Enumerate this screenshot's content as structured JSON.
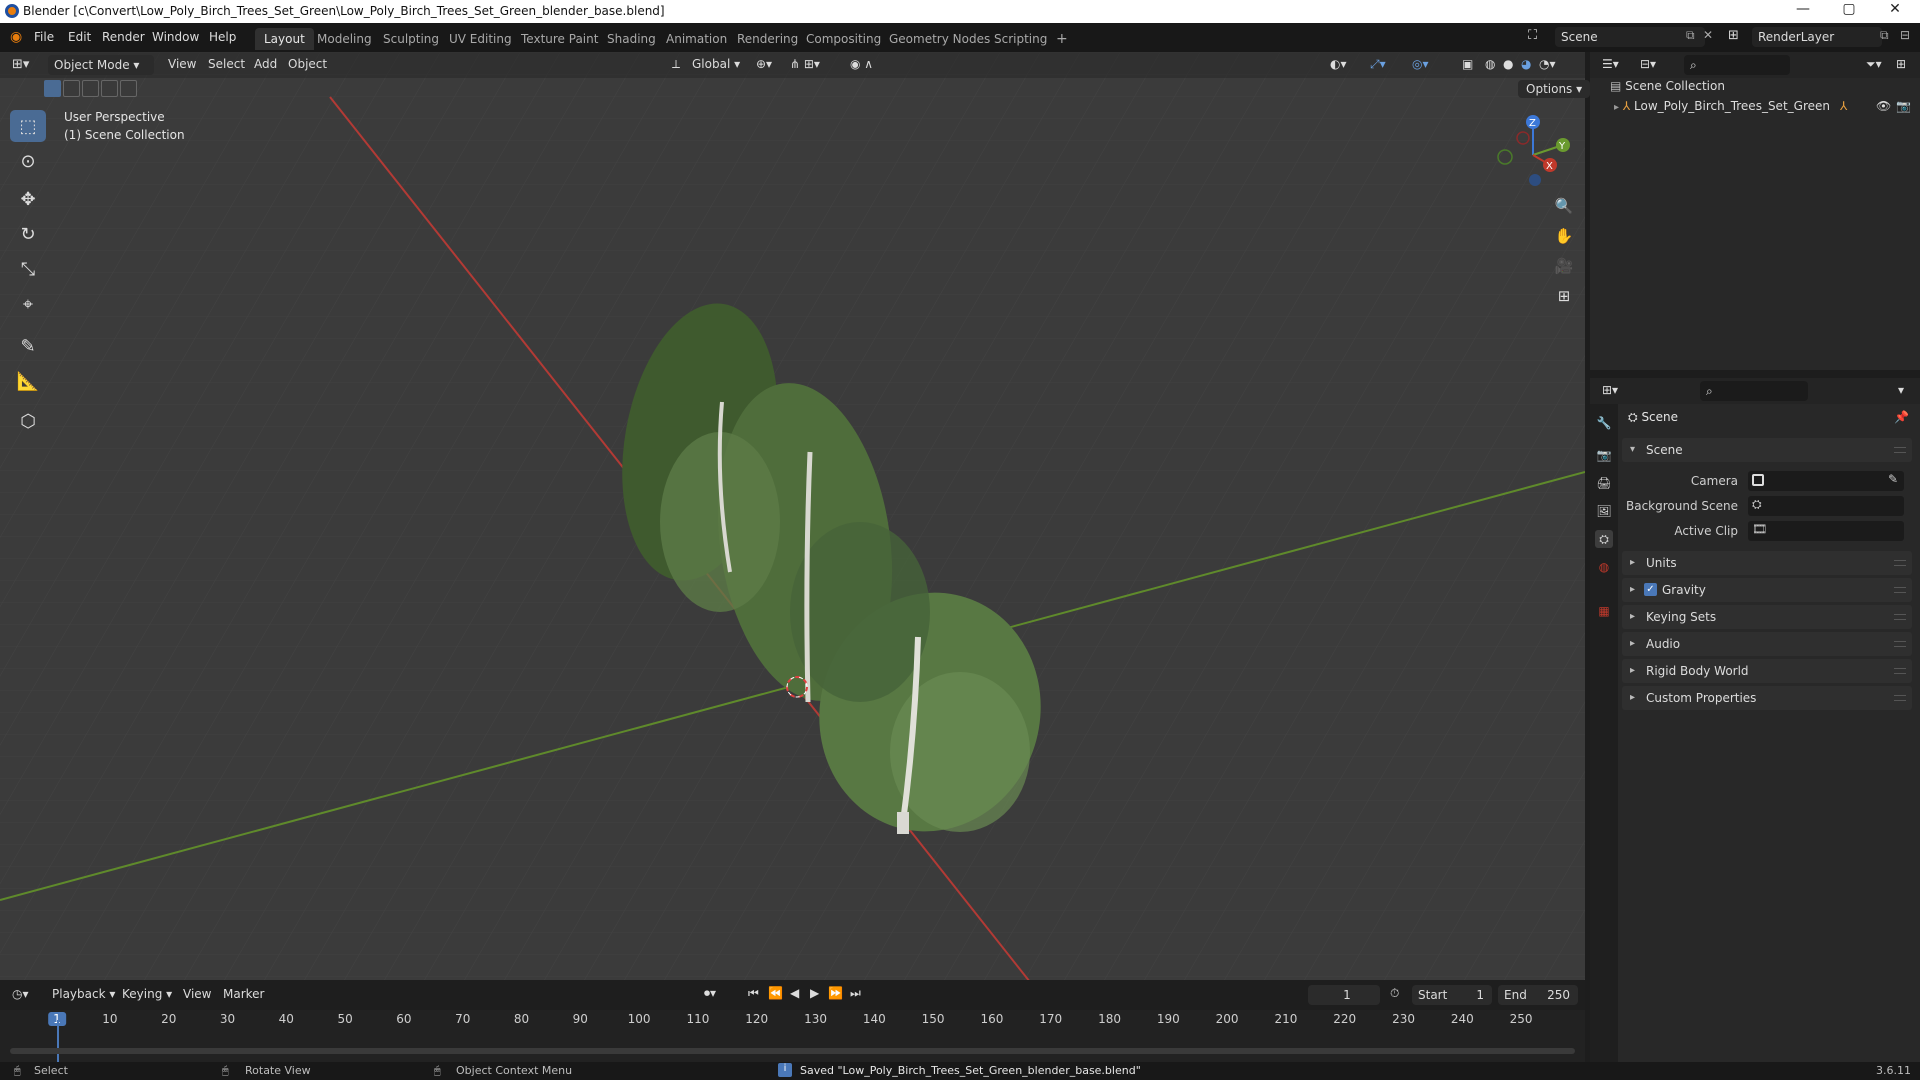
{
  "window": {
    "title": "Blender [c\\Convert\\Low_Poly_Birch_Trees_Set_Green\\Low_Poly_Birch_Trees_Set_Green_blender_base.blend]",
    "minimize": "—",
    "maximize": "▢",
    "close": "✕"
  },
  "menu": [
    "File",
    "Edit",
    "Render",
    "Window",
    "Help"
  ],
  "workspaces": [
    "Layout",
    "Modeling",
    "Sculpting",
    "UV Editing",
    "Texture Paint",
    "Shading",
    "Animation",
    "Rendering",
    "Compositing",
    "Geometry Nodes",
    "Scripting",
    "+"
  ],
  "active_workspace": "Layout",
  "scene_name": "Scene",
  "view_layer": "RenderLayer",
  "viewport_header": {
    "mode": "Object Mode",
    "menus": [
      "View",
      "Select",
      "Add",
      "Object"
    ],
    "transform_orientation": "Global",
    "options": "Options"
  },
  "viewport_overlay": {
    "line1": "User Perspective",
    "line2": "(1) Scene Collection"
  },
  "gizmo": {
    "x": "X",
    "y": "Y",
    "z": "Z"
  },
  "outliner": {
    "root": "Scene Collection",
    "items": [
      {
        "label": "Low_Poly_Birch_Trees_Set_Green"
      }
    ]
  },
  "properties": {
    "context": "Scene",
    "scene_panel": "Scene",
    "fields": [
      {
        "label": "Camera"
      },
      {
        "label": "Background Scene"
      },
      {
        "label": "Active Clip"
      }
    ],
    "sections": [
      "Units",
      "Gravity",
      "Keying Sets",
      "Audio",
      "Rigid Body World",
      "Custom Properties"
    ],
    "gravity_checked": true
  },
  "timeline": {
    "menus": [
      "Playback",
      "Keying",
      "View",
      "Marker"
    ],
    "current_frame": "1",
    "start_label": "Start",
    "start": "1",
    "end_label": "End",
    "end": "250",
    "ticks": [
      "1",
      "10",
      "20",
      "30",
      "40",
      "50",
      "60",
      "70",
      "80",
      "90",
      "100",
      "110",
      "120",
      "130",
      "140",
      "150",
      "160",
      "170",
      "180",
      "190",
      "200",
      "210",
      "220",
      "230",
      "240",
      "250"
    ]
  },
  "statusbar": {
    "select": "Select",
    "rotate": "Rotate View",
    "context_menu": "Object Context Menu",
    "message": "Saved \"Low_Poly_Birch_Trees_Set_Green_blender_base.blend\"",
    "version": "3.6.11"
  },
  "colors": {
    "accent": "#4a6b94",
    "x_axis": "#c0392b",
    "y_axis": "#6a9a2f",
    "z_axis": "#3c78d8",
    "foliage": "#4f6f3a"
  }
}
